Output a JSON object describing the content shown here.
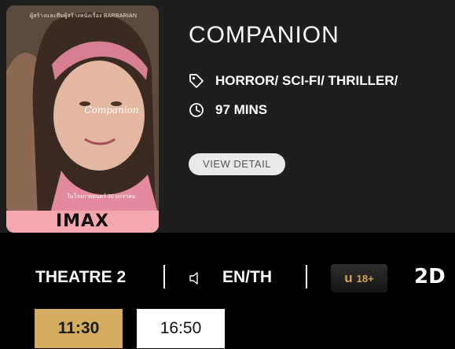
{
  "poster": {
    "tagline": "ผู้สร้างและทีมผู้สร้างหนังเรื่อง BARBARIAN",
    "title_art": "Companion",
    "release_line": "ในโรงภาพยนตร์ 30 มกราคม",
    "imax_label": "IMAX",
    "imax_color": "#f3a8ae"
  },
  "movie": {
    "title": "COMPANION",
    "genres": "HORROR/ SCI-FI/ THRILLER/",
    "duration": "97 MINS",
    "detail_button": "VIEW DETAIL"
  },
  "session": {
    "theatre": "THEATRE 2",
    "language": "EN/TH",
    "rating_u": "u",
    "rating_age": "18+",
    "format": "2D"
  },
  "showtimes": [
    {
      "time": "11:30",
      "selected": true
    },
    {
      "time": "16:50",
      "selected": false
    }
  ],
  "icons": {
    "genre": "tag-icon",
    "duration": "clock-icon",
    "audio": "speaker-icon"
  },
  "colors": {
    "accent_gold": "#d4ad63",
    "card_bg": "#1e1e1e",
    "page_bg": "#000000"
  }
}
